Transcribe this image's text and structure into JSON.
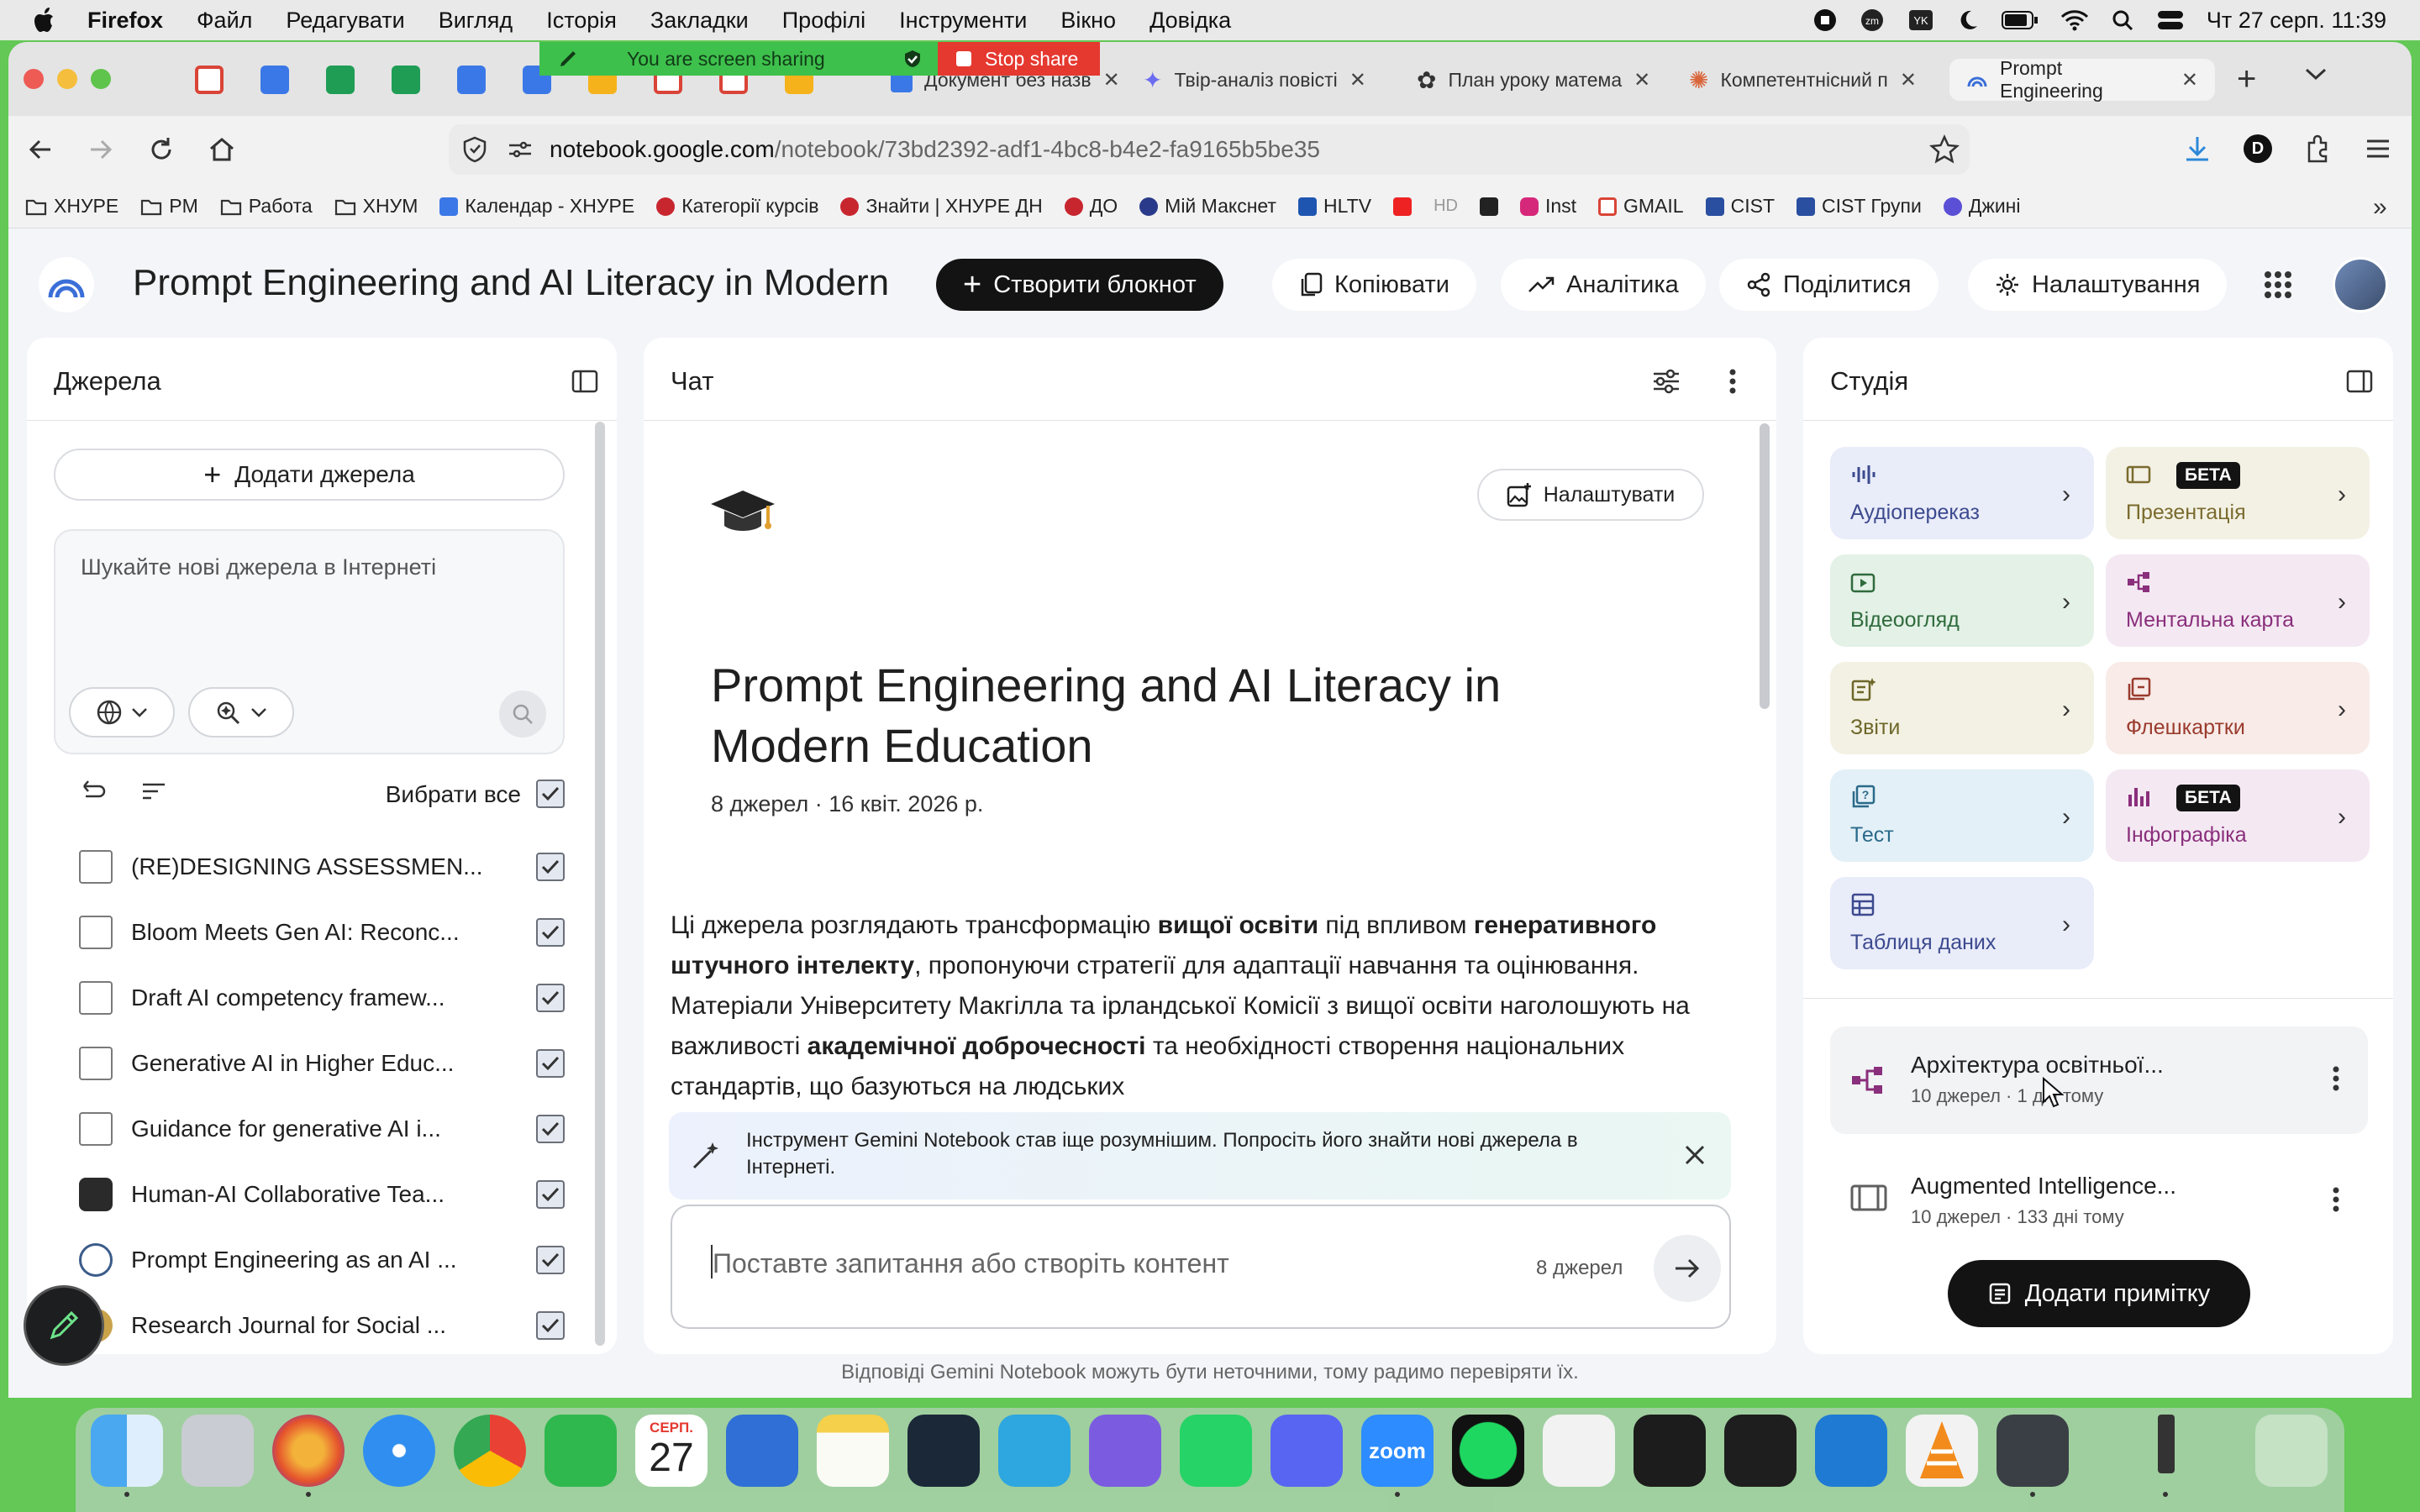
{
  "menubar": {
    "app": "Firefox",
    "items": [
      "Файл",
      "Редагувати",
      "Вигляд",
      "Історія",
      "Закладки",
      "Профілі",
      "Інструменти",
      "Вікно",
      "Довідка"
    ],
    "clock": "Чт 27 серп.  11:39"
  },
  "sharing": {
    "label": "You are screen sharing",
    "stop": "Stop share"
  },
  "tabs": [
    {
      "label": "Документ без назв"
    },
    {
      "label": "Твір-аналіз повісті"
    },
    {
      "label": "План уроку матема"
    },
    {
      "label": "Компетентнісний п"
    },
    {
      "label": "Prompt Engineering"
    }
  ],
  "url": {
    "host": "notebook.google.com",
    "path": "/notebook/73bd2392-adf1-4bc8-b4e2-fa9165b5be35"
  },
  "bookmarks": [
    "ХНУРЕ",
    "PM",
    "Работа",
    "ХНУМ",
    "Календар - ХНУРЕ",
    "Категорії курсів",
    "Знайти | ХНУРЕ ДН",
    "ДО",
    "Мій Макснет",
    "HLTV",
    "",
    "HD",
    "",
    "Inst",
    "GMAIL",
    "CIST",
    "CIST Групи",
    "Джині"
  ],
  "app": {
    "title": "Prompt Engineering and AI Literacy in Modern",
    "create": "Створити блокнот",
    "copy": "Копіювати",
    "analytics": "Аналітика",
    "share": "Поділитися",
    "settings": "Налаштування"
  },
  "sources": {
    "title": "Джерела",
    "add": "Додати джерела",
    "search_placeholder": "Шукайте нові джерела в Інтернеті",
    "select_all": "Вибрати все",
    "items": [
      "(RE)DESIGNING ASSESSMEN...",
      "Bloom Meets Gen AI: Reconc...",
      "Draft AI competency framew...",
      "Generative AI in Higher Educ...",
      "Guidance for generative AI i...",
      "Human-AI Collaborative Tea...",
      "Prompt Engineering as an AI ...",
      "Research Journal for Social ..."
    ]
  },
  "chat": {
    "title": "Чат",
    "configure": "Налаштувати",
    "nb_title": "Prompt Engineering and AI Literacy in Modern Education",
    "meta": "8 джерел · 16 квіт. 2026 р.",
    "summary": [
      {
        "t": "Ці джерела розглядають трансформацію ",
        "b": false
      },
      {
        "t": "вищої освіти",
        "b": true
      },
      {
        "t": " під впливом ",
        "b": false
      },
      {
        "t": "генеративного штучного інтелекту",
        "b": true
      },
      {
        "t": ", пропонуючи стратегії для адаптації навчання та оцінювання. Матеріали Університету Макгілла та ірландської Комісії з вищої освіти наголошують на важливості ",
        "b": false
      },
      {
        "t": "академічної доброчесності",
        "b": true
      },
      {
        "t": " та необхідності створення національних стандартів, що базуються на людських",
        "b": false
      }
    ],
    "notice": "Інструмент Gemini Notebook став іще розумнішим. Попросіть його знайти нові джерела в Інтернеті.",
    "input_placeholder": "Поставте запитання або створіть контент",
    "source_count": "8 джерел",
    "disclaimer": "Відповіді Gemini Notebook можуть бути неточними, тому радимо перевіряти їх."
  },
  "studio": {
    "title": "Студія",
    "beta": "БЕТА",
    "tiles": [
      {
        "label": "Аудіопереказ",
        "bg": "#e9ecf9",
        "fg": "#3c4a8f",
        "beta": false
      },
      {
        "label": "Презентація",
        "bg": "#f3f1e4",
        "fg": "#7a6b2e",
        "beta": true
      },
      {
        "label": "Відеоогляд",
        "bg": "#e3f1e6",
        "fg": "#2f6b3c",
        "beta": false
      },
      {
        "label": "Ментальна карта",
        "bg": "#f4e9f3",
        "fg": "#8a2f7c",
        "beta": false
      },
      {
        "label": "Звіти",
        "bg": "#f2f1e3",
        "fg": "#6d6628",
        "beta": false
      },
      {
        "label": "Флешкартки",
        "bg": "#f8ebe8",
        "fg": "#9a3b2d",
        "beta": false
      },
      {
        "label": "Тест",
        "bg": "#e3f0f7",
        "fg": "#2a6a8a",
        "beta": false
      },
      {
        "label": "Інфографіка",
        "bg": "#f4e9f3",
        "fg": "#8a2f7c",
        "beta": true
      },
      {
        "label": "Таблиця даних",
        "bg": "#e9ecf9",
        "fg": "#3c4a8f",
        "beta": false
      }
    ],
    "notes": [
      {
        "title": "Архітектура освітньої...",
        "meta": "10 джерел · 1 дні тому"
      },
      {
        "title": "Augmented Intelligence...",
        "meta": "10 джерел · 133 дні тому"
      }
    ],
    "add_note": "Додати примітку"
  },
  "dock": {
    "calendar_month": "СЕРП.",
    "calendar_day": "27",
    "zoom": "zoom"
  }
}
